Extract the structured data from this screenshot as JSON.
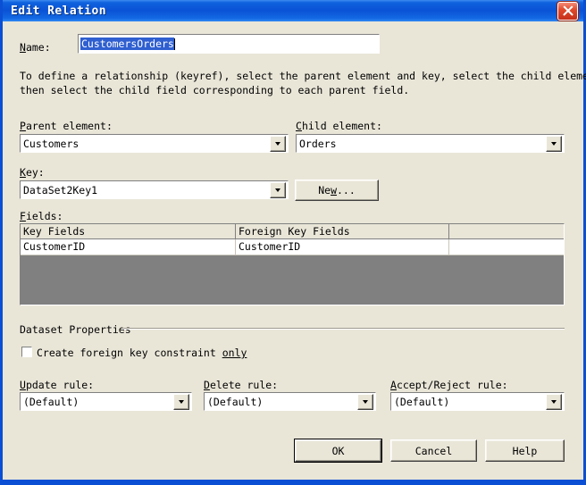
{
  "window": {
    "title": "Edit Relation",
    "close_icon": "close-icon",
    "accent_titlebar": "#0a52d6",
    "background": "#e9e6d8",
    "selection_color": "#2f5fd0",
    "grid_empty_color": "#808080"
  },
  "name_field": {
    "label": "Name:",
    "label_accel": "N",
    "value": "CustomersOrders",
    "selected": true
  },
  "description": {
    "line1": "To define a relationship (keyref), select the parent element and key, select the child element, and",
    "line2": "then select the child field corresponding to each parent field."
  },
  "parent_element": {
    "label": "Parent element:",
    "label_accel": "P",
    "value": "Customers",
    "arrow_icon": "chevron-down-icon"
  },
  "child_element": {
    "label": "Child element:",
    "label_accel": "C",
    "value": "Orders",
    "arrow_icon": "chevron-down-icon"
  },
  "key": {
    "label": "Key:",
    "label_accel": "K",
    "value": "DataSet2Key1",
    "arrow_icon": "chevron-down-icon",
    "new_button": "New..."
  },
  "fields": {
    "label": "Fields:",
    "label_accel": "F",
    "columns": [
      "Key Fields",
      "Foreign Key Fields"
    ],
    "rows": [
      [
        "CustomerID",
        "CustomerID"
      ]
    ]
  },
  "dataset_properties": {
    "group_label": "Dataset Properties",
    "checkbox_label": "Create foreign key constraint only",
    "checkbox_checked": false,
    "update_rule": {
      "label": "Update rule:",
      "label_accel": "U",
      "value": "(Default)",
      "arrow_icon": "chevron-down-icon"
    },
    "delete_rule": {
      "label": "Delete rule:",
      "label_accel": "D",
      "value": "(Default)",
      "arrow_icon": "chevron-down-icon"
    },
    "accept_reject_rule": {
      "label": "Accept/Reject rule:",
      "label_accel": "A",
      "value": "(Default)",
      "arrow_icon": "chevron-down-icon"
    }
  },
  "buttons": {
    "ok": "OK",
    "cancel": "Cancel",
    "help": "Help"
  }
}
